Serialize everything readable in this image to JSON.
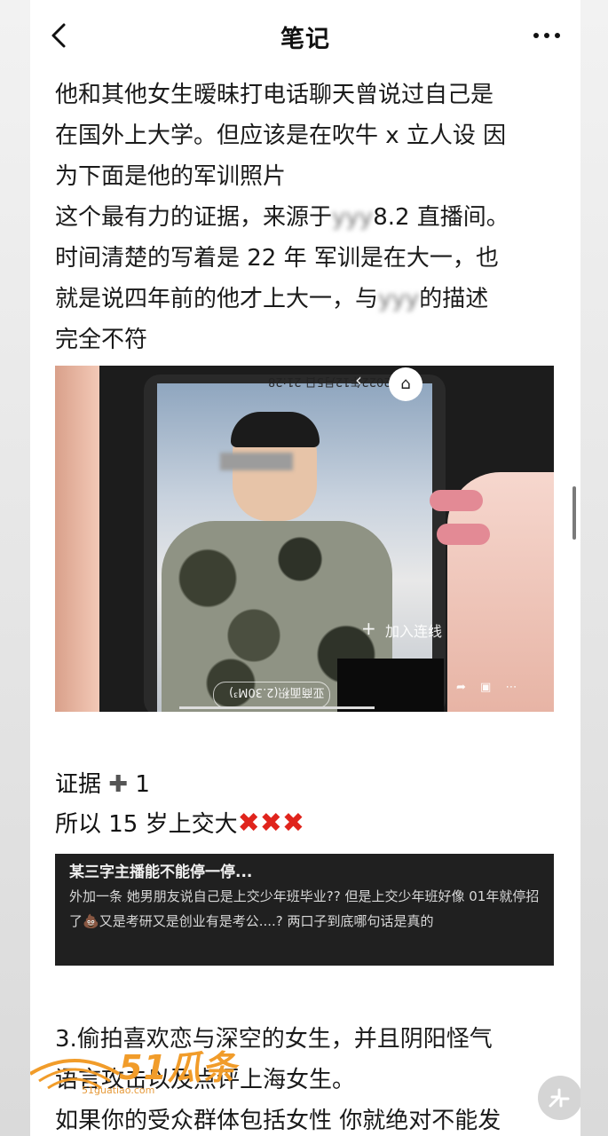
{
  "header": {
    "title": "笔记"
  },
  "body": {
    "lines": [
      "他和其他女生暧昧打电话聊天曾说过自己是",
      "在国外上大学。但应该是在吹牛 x 立人设 因",
      "为下面是他的军训照片"
    ],
    "line4_pre": "这个最有力的证据，来源于",
    "line4_blur": "yyy",
    "line4_post": "8.2 直播间。",
    "line5": "时间清楚的写着是 22 年 军训是在大一，也",
    "line6_pre": "就是说四年前的他才上大一，与",
    "line6_blur": "yyy",
    "line6_post": "的描述",
    "line7": "完全不符"
  },
  "photo": {
    "timestamp": "2022年12月5日 21:28",
    "join_label": "加入连线",
    "dimension_label": "亚商面积(2.30M³)"
  },
  "evidence": {
    "line1_text": "证据",
    "line1_count": "1",
    "line2_text": "所以 15 岁上交大",
    "crosses": "✖✖✖"
  },
  "quote_card": {
    "title": "某三字主播能不能停一停...",
    "text_part1": "外加一条 她男朋友说自己是上交少年班毕业?? 但是上交少年班好像 01年就停招了",
    "emoji": "💩",
    "text_part2": "又是考研又是创业有是考公....? 两口子到底哪句话是真的"
  },
  "section3": {
    "lines": [
      "3.偷拍喜欢恋与深空的女生，并且阴阳怪气",
      "语言攻击以及点评上海女生。",
      "如果你的受众群体包括女性 你就绝对不能发"
    ]
  },
  "watermark": {
    "brand": "51瓜条",
    "url": "51guatiao.com"
  },
  "colors": {
    "accent_red": "#e0241c",
    "card_bg": "#202020",
    "watermark_orange": "#f19c2a"
  }
}
